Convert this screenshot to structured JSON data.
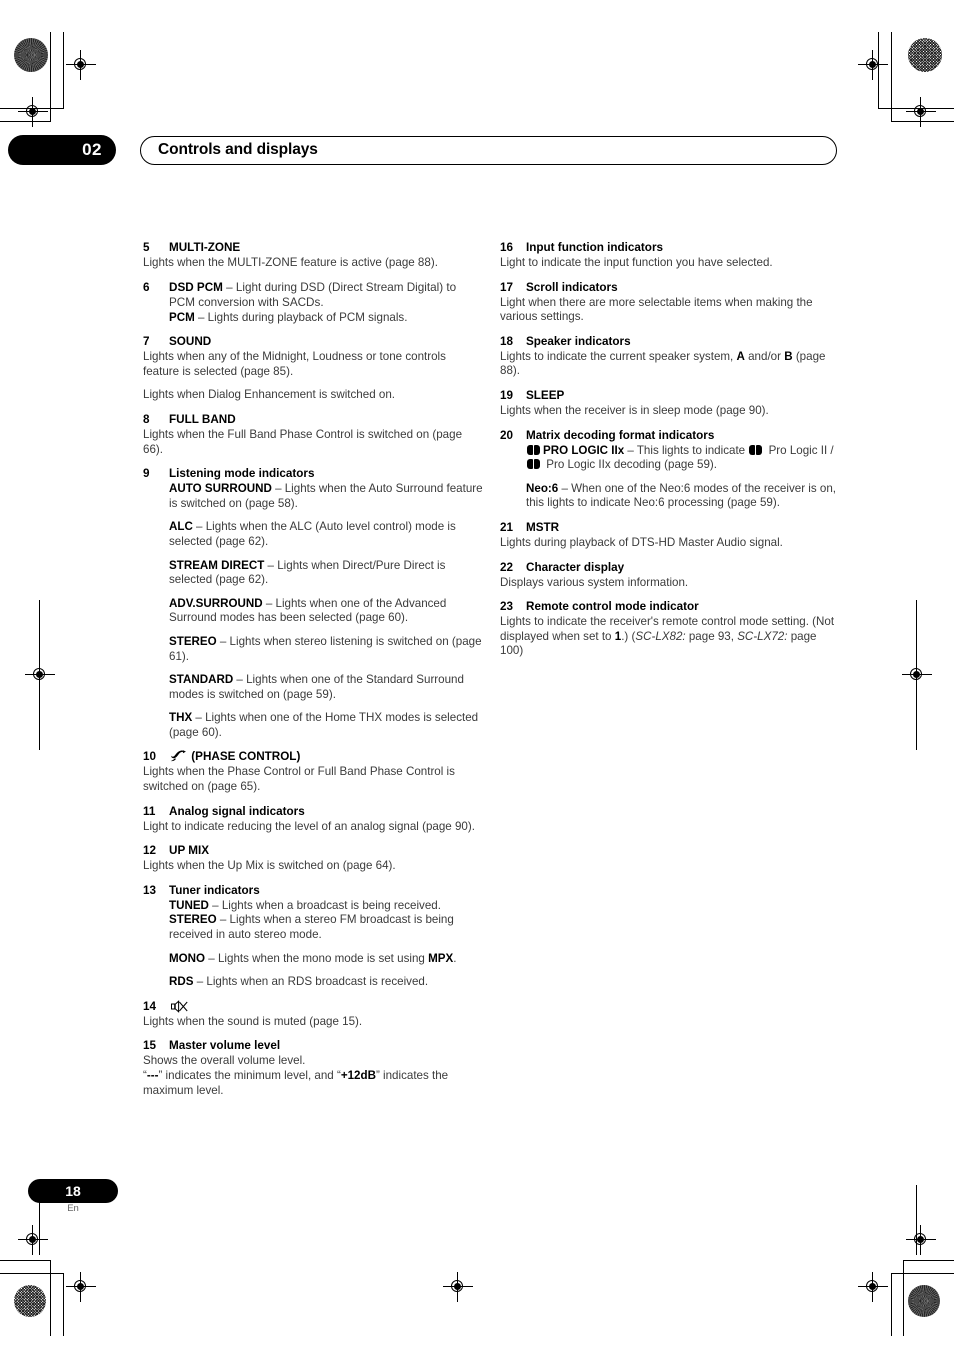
{
  "header": {
    "chapter_number": "02",
    "title": "Controls and displays"
  },
  "footer": {
    "page_number": "18",
    "language": "En"
  },
  "icons": {
    "phase_control": "phase-control-icon",
    "mute": "mute-icon",
    "dolby": "dolby-double-d-icon"
  },
  "left_column": {
    "items": [
      {
        "num": "5",
        "head": "MULTI-ZONE",
        "body": "Lights when the MULTI-ZONE feature is active (page 88)."
      },
      {
        "num": "6",
        "head_inline_bold": "DSD PCM",
        "head_inline_rest": " – Light during DSD (Direct Stream Digital) to PCM conversion with SACDs.",
        "sub_bold": "PCM",
        "sub_rest": " – Lights during playback of PCM signals."
      },
      {
        "num": "7",
        "head": "SOUND",
        "body": "Lights when any of the Midnight, Loudness or tone controls feature is selected (page 85).",
        "body2": "Lights when Dialog Enhancement is switched on."
      },
      {
        "num": "8",
        "head": "FULL BAND",
        "body": "Lights when the Full Band Phase Control is switched on (page 66)."
      },
      {
        "num": "9",
        "head": "Listening mode indicators",
        "subitems": [
          {
            "bold": "AUTO SURROUND",
            "rest": " – Lights when the Auto Surround feature is switched on (page 58)."
          },
          {
            "bold": "ALC",
            "rest": " – Lights when the ALC (Auto level control) mode is selected (page 62)."
          },
          {
            "bold": "STREAM DIRECT",
            "rest": " – Lights when Direct/Pure Direct is selected (page 62)."
          },
          {
            "bold": "ADV.SURROUND",
            "rest": " – Lights when one of the Advanced Surround modes has been selected (page 60)."
          },
          {
            "bold": "STEREO",
            "rest": " – Lights when stereo listening is switched on (page 61)."
          },
          {
            "bold": "STANDARD",
            "rest": " – Lights when one of the Standard Surround modes is switched on (page 59)."
          },
          {
            "bold": "THX",
            "rest": " – Lights when one of the Home THX modes is selected (page 60)."
          }
        ]
      },
      {
        "num": "10",
        "head": "(PHASE CONTROL)",
        "body": "Lights when the Phase Control or Full Band Phase Control is switched on (page 65)."
      },
      {
        "num": "11",
        "head": "Analog signal indicators",
        "body": "Light to indicate reducing the level of an analog signal (page 90)."
      },
      {
        "num": "12",
        "head": "UP MIX",
        "body": "Lights when the Up Mix is switched on (page 64)."
      },
      {
        "num": "13",
        "head": "Tuner indicators",
        "subitems": [
          {
            "bold": "TUNED",
            "rest": " – Lights when a broadcast is being received."
          },
          {
            "bold": "STEREO",
            "rest": " – Lights when a stereo FM broadcast is being received in auto stereo mode."
          },
          {
            "bold": "MONO",
            "rest": " – Lights when the mono mode is set using ",
            "bold2": "MPX",
            "rest2": "."
          },
          {
            "bold": "RDS",
            "rest": " – Lights when an RDS broadcast is received."
          }
        ]
      },
      {
        "num": "14",
        "head": "",
        "body": "Lights when the sound is muted (page 15)."
      },
      {
        "num": "15",
        "head": "Master volume level",
        "body": "Shows the overall volume level.",
        "body2_pre": "“",
        "body2_bold": "---",
        "body2_mid": "” indicates the minimum level, and “",
        "body2_bold2": "+12dB",
        "body2_post": "” indicates the maximum level."
      }
    ]
  },
  "right_column": {
    "items": [
      {
        "num": "16",
        "head": "Input function indicators",
        "body": "Light to indicate the input function you have selected."
      },
      {
        "num": "17",
        "head": "Scroll indicators",
        "body": "Light when there are more selectable items when making the various settings."
      },
      {
        "num": "18",
        "head": "Speaker indicators",
        "body_pre": "Lights to indicate the current speaker system, ",
        "body_bold": "A",
        "body_mid": " and/or ",
        "body_bold2": "B",
        "body_post": " (page 88)."
      },
      {
        "num": "19",
        "head": "SLEEP",
        "body": "Lights when the receiver is in sleep mode (page 90)."
      },
      {
        "num": "20",
        "head": "Matrix decoding format indicators",
        "sub1_bold": "PRO LOGIC IIx",
        "sub1_a": " – This lights to indicate ",
        "sub1_b": " Pro Logic II / ",
        "sub1_c": " Pro Logic IIx decoding (page 59).",
        "sub2_bold": "Neo:6",
        "sub2_rest": " – When one of the Neo:6 modes of the receiver is on, this lights to indicate Neo:6 processing (page 59)."
      },
      {
        "num": "21",
        "head": "MSTR",
        "body": "Lights during playback of DTS-HD Master Audio signal."
      },
      {
        "num": "22",
        "head": "Character display",
        "body": "Displays various system information."
      },
      {
        "num": "23",
        "head": "Remote control mode indicator",
        "body_pre": "Lights to indicate the receiver's remote control mode setting. (Not displayed when set to ",
        "body_bold": "1",
        "body_mid": ".) (",
        "body_italic": "SC-LX82:",
        "body_mid2": " page 93, ",
        "body_italic2": "SC-LX72:",
        "body_post": " page 100)"
      }
    ]
  }
}
